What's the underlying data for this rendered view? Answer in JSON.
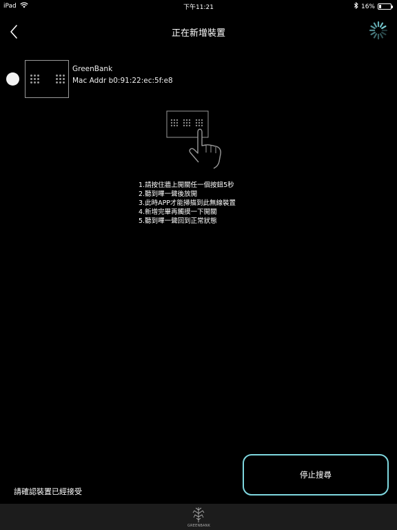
{
  "status_bar": {
    "device": "iPad",
    "time": "下午11:21",
    "battery": "16%",
    "battery_level": 0.16
  },
  "nav": {
    "title": "正在新增裝置",
    "back_icon": "chevron-left-icon",
    "spinner_icon": "loading-spinner-icon",
    "accent_color": "#7fd8e0"
  },
  "device": {
    "name": "GreenBank",
    "mac": "Mac Addr b0:91:22:ec:5f:e8"
  },
  "instructions": [
    "1.請按住牆上開關任一個按鈕5秒",
    "2.聽到嗶一聲後放開",
    "3.此時APP才能掃描到此無線裝置",
    "4.新增完畢再觸摸一下開關",
    "5.聽到嗶一聲回到正常狀態"
  ],
  "bottom": {
    "confirm_text": "請確認裝置已經接受",
    "stop_button_label": "停止搜尋"
  },
  "footer": {
    "logo_text": "GREENBANK"
  }
}
